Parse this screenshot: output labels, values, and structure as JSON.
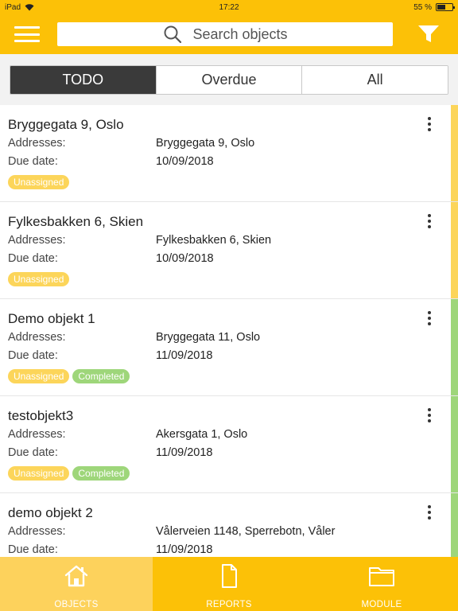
{
  "status_bar": {
    "device": "iPad",
    "time": "17:22",
    "battery_text": "55 %",
    "battery_level": 0.55
  },
  "header": {
    "search_placeholder": "Search objects",
    "icons": {
      "menu": "hamburger-icon",
      "search": "search-icon",
      "filter": "filter-funnel-icon"
    }
  },
  "tabs": [
    {
      "label": "TODO",
      "active": true
    },
    {
      "label": "Overdue",
      "active": false
    },
    {
      "label": "All",
      "active": false
    }
  ],
  "labels": {
    "addresses": "Addresses:",
    "due_date": "Due date:"
  },
  "colors": {
    "brand": "#fcc107",
    "strip_pending": "#fcd55a",
    "strip_completed": "#9ed67a",
    "badge_unassigned": "#fcd55a",
    "badge_completed": "#9ed67a"
  },
  "objects": [
    {
      "title": "Bryggegata 9, Oslo",
      "address": "Bryggegata 9, Oslo",
      "due_date": "10/09/2018",
      "badges": [
        "Unassigned"
      ],
      "status": "pending"
    },
    {
      "title": "Fylkesbakken 6, Skien",
      "address": "Fylkesbakken 6, Skien",
      "due_date": "10/09/2018",
      "badges": [
        "Unassigned"
      ],
      "status": "pending"
    },
    {
      "title": "Demo objekt 1",
      "address": "Bryggegata 11, Oslo",
      "due_date": "11/09/2018",
      "badges": [
        "Unassigned",
        "Completed"
      ],
      "status": "completed"
    },
    {
      "title": "testobjekt3",
      "address": "Akersgata 1, Oslo",
      "due_date": "11/09/2018",
      "badges": [
        "Unassigned",
        "Completed"
      ],
      "status": "completed"
    },
    {
      "title": "demo objekt 2",
      "address": "Vålerveien 1148, Sperrebotn, Våler",
      "due_date": "11/09/2018",
      "badges": [],
      "status": "completed"
    }
  ],
  "bottom_nav": [
    {
      "label": "OBJECTS",
      "icon": "home-icon",
      "active": true
    },
    {
      "label": "REPORTS",
      "icon": "document-icon",
      "active": false
    },
    {
      "label": "MODULE",
      "icon": "folder-icon",
      "active": false
    }
  ]
}
